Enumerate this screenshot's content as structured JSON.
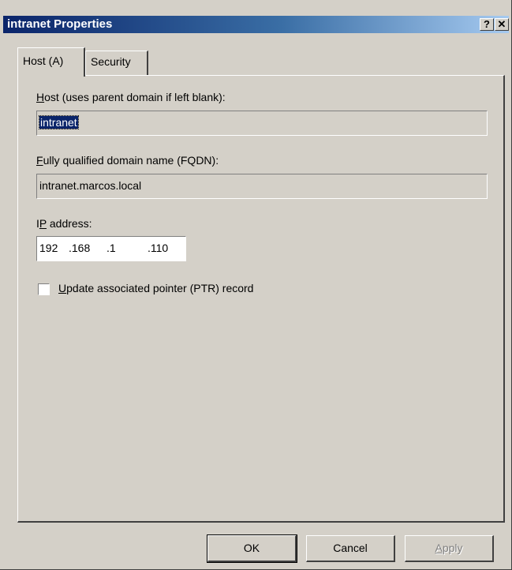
{
  "window": {
    "title": "intranet Properties",
    "help_label": "?",
    "close_label": "✕"
  },
  "tabs": [
    {
      "label": "Host (A)",
      "active": true
    },
    {
      "label": "Security",
      "active": false
    }
  ],
  "host": {
    "label_mnemonic": "H",
    "label_rest": "ost (uses parent domain if left blank):",
    "value": "intranet"
  },
  "fqdn": {
    "label_mnemonic": "F",
    "label_rest": "ully qualified domain name (FQDN):",
    "value": "intranet.marcos.local"
  },
  "ip": {
    "label_pre": "I",
    "label_mnemonic": "P",
    "label_rest": " address:",
    "octets": [
      "192",
      ".168",
      ".1",
      ".110"
    ]
  },
  "ptr": {
    "checked": false,
    "label_mnemonic": "U",
    "label_rest": "pdate associated pointer (PTR) record"
  },
  "buttons": {
    "ok": "OK",
    "cancel": "Cancel",
    "apply_mnemonic": "A",
    "apply_rest": "pply"
  }
}
